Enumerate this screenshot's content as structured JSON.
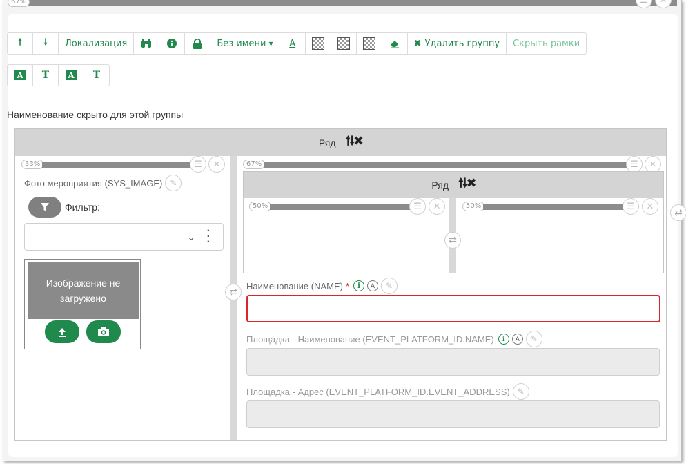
{
  "outer": {
    "width_badge": "67%"
  },
  "toolbar": {
    "up_icon": "arrow-up-icon",
    "down_icon": "arrow-down-icon",
    "localization": "Локализация",
    "binoculars_icon": "binoculars-icon",
    "info_icon": "info-icon",
    "lock_icon": "lock-icon",
    "name_dropdown": "Без имени",
    "font_color_letter": "A",
    "eraser_icon": "eraser-icon",
    "delete_group": "Удалить группу",
    "hide_frames": "Скрыть рамки",
    "row2": [
      "A",
      "T",
      "A",
      "T"
    ]
  },
  "caption": "Наименование скрыто для этой группы",
  "row": {
    "label": "Ряд",
    "arrows": "🠕🠗✖"
  },
  "left_col": {
    "width": "33%",
    "photo_label": "Фото мероприятия (SYS_IMAGE)",
    "filter_label": "Фильтр:",
    "image_placeholder": "Изображение не загружено"
  },
  "right_col": {
    "width": "67%",
    "inner_row_label": "Ряд",
    "inner_left_width": "50%",
    "inner_right_width": "50%",
    "fields": [
      {
        "label": "Наименование (NAME)",
        "required": "*"
      },
      {
        "label": "Площадка - Наименование (EVENT_PLATFORM_ID.NAME)"
      },
      {
        "label": "Площадка - Адрес (EVENT_PLATFORM_ID.EVENT_ADDRESS)"
      }
    ]
  },
  "colors": {
    "accent": "#1f8a4c",
    "error": "#d9252b",
    "bar": "#8c8c8c",
    "header": "#d4d4d4"
  }
}
